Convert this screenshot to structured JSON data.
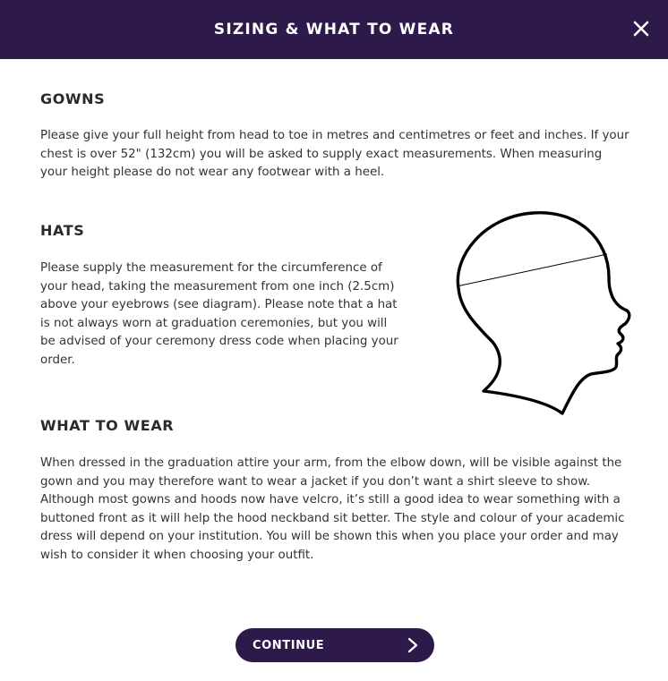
{
  "header": {
    "title": "SIZING & WHAT TO WEAR",
    "close_icon": "close-icon"
  },
  "sections": {
    "gowns": {
      "heading": "GOWNS",
      "text": "Please give your full height from head to toe in metres and centimetres or feet and inches. If your chest is over 52\" (132cm) you will be asked to supply exact measurements. When measuring your height please do not wear any footwear with a heel."
    },
    "hats": {
      "heading": "HATS",
      "text": "Please supply the measurement for the circumference of your head, taking the measurement from one inch (2.5cm) above your eyebrows (see diagram). Please note that a hat is not always worn at graduation ceremonies, but you will be advised of your ceremony dress code when placing your order."
    },
    "what_to_wear": {
      "heading": "WHAT TO WEAR",
      "text": "When dressed in the graduation attire your arm, from the elbow down, will be visible against the gown and you may therefore want to wear a jacket if you don’t want a shirt sleeve to show. Although most gowns and hoods now have velcro, it’s still a good idea to wear something with a buttoned front as it will help the hood neckband sit better. The style and colour of your academic dress will depend on your institution. You will be shown this when you place your order and may wish to consider it when choosing your outfit."
    }
  },
  "diagram": {
    "icon": "head-measurement-diagram"
  },
  "footer": {
    "continue_label": "CONTINUE",
    "continue_icon": "chevron-right-icon"
  },
  "colors": {
    "brand": "#2d1a4a",
    "text": "#333333",
    "background": "#ffffff"
  }
}
